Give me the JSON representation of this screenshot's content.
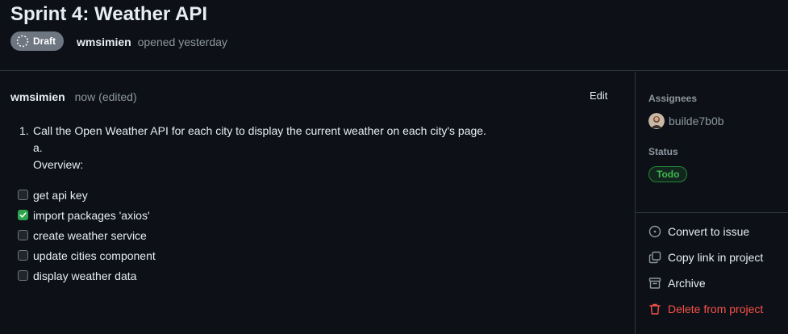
{
  "header": {
    "title": "Sprint 4: Weather API",
    "badge": "Draft",
    "author": "wmsimien",
    "opened_text": "opened yesterday"
  },
  "comment": {
    "author": "wmsimien",
    "time": "now (edited)",
    "edit_label": "Edit",
    "list": [
      {
        "num": "1.",
        "text": "Call the Open Weather API for each city to display the current weather on each city's page."
      }
    ],
    "sub_marker": "a.",
    "overview": "Overview:",
    "tasks": [
      {
        "label": "get api key",
        "checked": false
      },
      {
        "label": "import packages 'axios'",
        "checked": true
      },
      {
        "label": "create weather service",
        "checked": false
      },
      {
        "label": "update cities component",
        "checked": false
      },
      {
        "label": "display weather data",
        "checked": false
      }
    ]
  },
  "sidebar": {
    "assignees_label": "Assignees",
    "assignee": "builde7b0b",
    "status_label": "Status",
    "status": "Todo",
    "actions": [
      {
        "label": "Convert to issue",
        "icon": "issue-opened-icon"
      },
      {
        "label": "Copy link in project",
        "icon": "copy-icon"
      },
      {
        "label": "Archive",
        "icon": "archive-icon"
      },
      {
        "label": "Delete from project",
        "icon": "trash-icon"
      }
    ]
  },
  "colors": {
    "background": "#0d1117",
    "border": "#30363d",
    "muted": "#8d96a0",
    "success": "#3fb950",
    "danger": "#f85149",
    "checkbox_checked": "#2da44e"
  }
}
